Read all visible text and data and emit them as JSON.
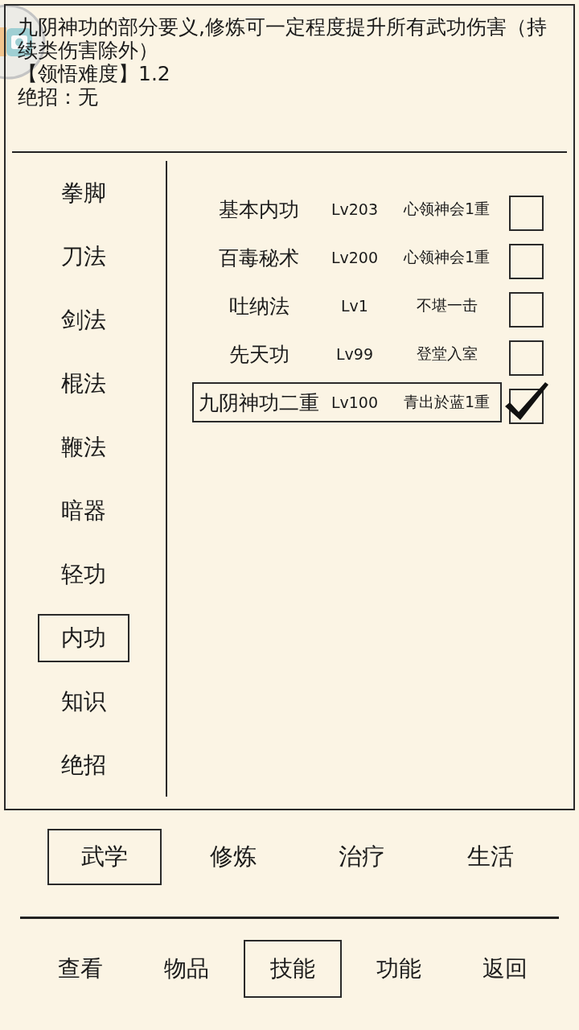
{
  "description": {
    "text": "九阴神功的部分要义,修炼可一定程度提升所有武功伤害（持续类伤害除外）",
    "difficulty": "【领悟难度】1.2",
    "ultimate": "绝招：无"
  },
  "categories": [
    {
      "label": "拳脚",
      "selected": false
    },
    {
      "label": "刀法",
      "selected": false
    },
    {
      "label": "剑法",
      "selected": false
    },
    {
      "label": "棍法",
      "selected": false
    },
    {
      "label": "鞭法",
      "selected": false
    },
    {
      "label": "暗器",
      "selected": false
    },
    {
      "label": "轻功",
      "selected": false
    },
    {
      "label": "内功",
      "selected": true
    },
    {
      "label": "知识",
      "selected": false
    },
    {
      "label": "绝招",
      "selected": false
    }
  ],
  "skills": [
    {
      "name": "基本内功",
      "lv": "Lv203",
      "stage": "心领神会1重",
      "selected": false,
      "checked": false
    },
    {
      "name": "百毒秘术",
      "lv": "Lv200",
      "stage": "心领神会1重",
      "selected": false,
      "checked": false
    },
    {
      "name": "吐纳法",
      "lv": "Lv1",
      "stage": "不堪一击",
      "selected": false,
      "checked": false
    },
    {
      "name": "先天功",
      "lv": "Lv99",
      "stage": "登堂入室",
      "selected": false,
      "checked": false
    },
    {
      "name": "九阴神功二重",
      "lv": "Lv100",
      "stage": "青出於蓝1重",
      "selected": true,
      "checked": true
    }
  ],
  "tabs": [
    {
      "label": "武学",
      "selected": true
    },
    {
      "label": "修炼",
      "selected": false
    },
    {
      "label": "治疗",
      "selected": false
    },
    {
      "label": "生活",
      "selected": false
    }
  ],
  "nav": [
    {
      "label": "查看",
      "selected": false
    },
    {
      "label": "物品",
      "selected": false
    },
    {
      "label": "技能",
      "selected": true
    },
    {
      "label": "功能",
      "selected": false
    },
    {
      "label": "返回",
      "selected": false
    }
  ]
}
